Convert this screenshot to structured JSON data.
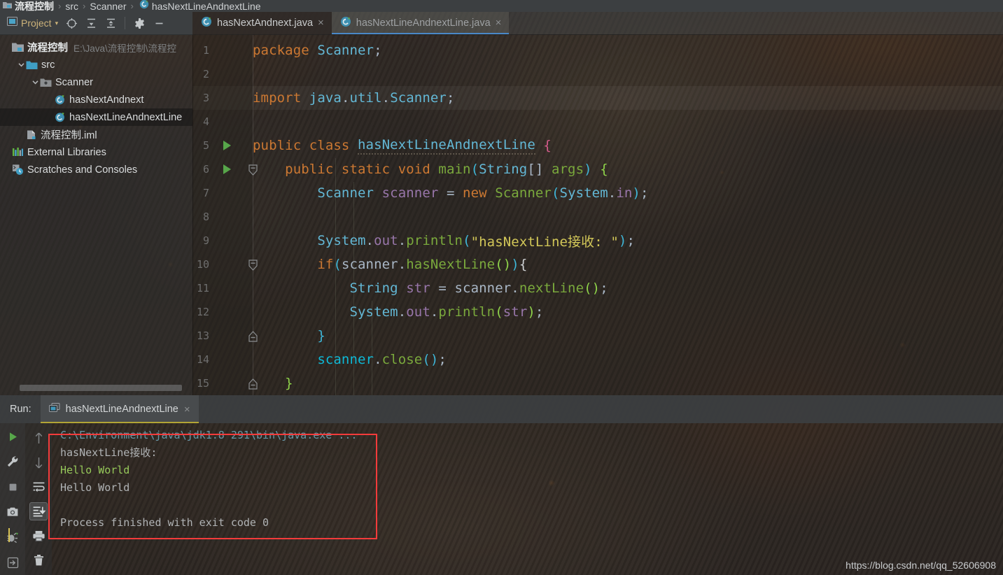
{
  "breadcrumb": {
    "items": [
      {
        "label": "流程控制",
        "icon": "project-icon",
        "bold": true
      },
      {
        "label": "src",
        "icon": "none",
        "bold": false
      },
      {
        "label": "Scanner",
        "icon": "none",
        "bold": false
      },
      {
        "label": "hasNextLineAndnextLine",
        "icon": "java-class-icon",
        "bold": false
      }
    ],
    "separator": "›"
  },
  "toolbar": {
    "project_label": "Project",
    "project_caret": "▾",
    "buttons": [
      {
        "name": "locate-icon",
        "title": "Select Opened File"
      },
      {
        "name": "expand-all-icon",
        "title": "Expand All"
      },
      {
        "name": "collapse-all-icon",
        "title": "Collapse All"
      },
      {
        "name": "gear-icon",
        "title": "Settings"
      },
      {
        "name": "minimize-icon",
        "title": "Hide"
      }
    ]
  },
  "editor_tabs": [
    {
      "label": "hasNextAndnext.java",
      "icon": "java-class-icon",
      "active": false,
      "close": "×"
    },
    {
      "label": "hasNextLineAndnextLine.java",
      "icon": "java-class-icon",
      "active": true,
      "close": "×"
    }
  ],
  "project_tree": [
    {
      "label": "流程控制",
      "path": "E:\\Java\\流程控制\\流程控",
      "icon": "project-folder-icon",
      "indent": 0,
      "arrow": "",
      "bold": true,
      "selected": false
    },
    {
      "label": "src",
      "path": "",
      "icon": "source-folder-icon",
      "indent": 1,
      "arrow": "▾",
      "bold": false,
      "selected": false
    },
    {
      "label": "Scanner",
      "path": "",
      "icon": "package-folder-icon",
      "indent": 2,
      "arrow": "▾",
      "bold": false,
      "selected": false
    },
    {
      "label": "hasNextAndnext",
      "path": "",
      "icon": "java-class-icon",
      "indent": 3,
      "arrow": "",
      "bold": false,
      "selected": false
    },
    {
      "label": "hasNextLineAndnextLine",
      "path": "",
      "icon": "java-class-icon",
      "indent": 3,
      "arrow": "",
      "bold": false,
      "selected": true
    },
    {
      "label": "流程控制.iml",
      "path": "",
      "icon": "iml-file-icon",
      "indent": 1,
      "arrow": "",
      "bold": false,
      "selected": false
    },
    {
      "label": "External Libraries",
      "path": "",
      "icon": "libraries-icon",
      "indent": 0,
      "arrow": "",
      "bold": false,
      "selected": false
    },
    {
      "label": "Scratches and Consoles",
      "path": "",
      "icon": "scratches-icon",
      "indent": 0,
      "arrow": "",
      "bold": false,
      "selected": false
    }
  ],
  "code": {
    "line_numbers": [
      1,
      2,
      3,
      4,
      5,
      6,
      7,
      8,
      9,
      10,
      11,
      12,
      13,
      14,
      15
    ],
    "lines": [
      {
        "n": 1,
        "tokens": [
          {
            "t": "package ",
            "c": "kw"
          },
          {
            "t": "Scanner",
            "c": "cls"
          },
          {
            "t": ";",
            "c": "punct"
          }
        ]
      },
      {
        "n": 2,
        "tokens": []
      },
      {
        "n": 3,
        "tokens": [
          {
            "t": "import ",
            "c": "kw"
          },
          {
            "t": "java",
            "c": "cls"
          },
          {
            "t": ".",
            "c": "punct"
          },
          {
            "t": "util",
            "c": "cls"
          },
          {
            "t": ".",
            "c": "punct"
          },
          {
            "t": "Scanner",
            "c": "cls"
          },
          {
            "t": ";",
            "c": "punct"
          }
        ]
      },
      {
        "n": 4,
        "tokens": []
      },
      {
        "n": 5,
        "tokens": [
          {
            "t": "public class ",
            "c": "kw"
          },
          {
            "t": "hasNextLineAndnextLine",
            "c": "cls wavy"
          },
          {
            "t": " ",
            "c": "punct"
          },
          {
            "t": "{",
            "c": "brc1"
          }
        ]
      },
      {
        "n": 6,
        "tokens": [
          {
            "t": "    ",
            "c": "punct"
          },
          {
            "t": "public static void ",
            "c": "kw"
          },
          {
            "t": "main",
            "c": "mth"
          },
          {
            "t": "(",
            "c": "brc3"
          },
          {
            "t": "String",
            "c": "cls"
          },
          {
            "t": "[] ",
            "c": "punct"
          },
          {
            "t": "args",
            "c": "mth"
          },
          {
            "t": ") ",
            "c": "brc3"
          },
          {
            "t": "{",
            "c": "brc2"
          }
        ]
      },
      {
        "n": 7,
        "tokens": [
          {
            "t": "        ",
            "c": "punct"
          },
          {
            "t": "Scanner",
            "c": "cls"
          },
          {
            "t": " ",
            "c": "punct"
          },
          {
            "t": "scanner",
            "c": "var"
          },
          {
            "t": " = ",
            "c": "punct"
          },
          {
            "t": "new ",
            "c": "kw"
          },
          {
            "t": "Scanner",
            "c": "mth"
          },
          {
            "t": "(",
            "c": "brc3"
          },
          {
            "t": "System",
            "c": "cls"
          },
          {
            "t": ".",
            "c": "punct"
          },
          {
            "t": "in",
            "c": "fld"
          },
          {
            "t": ")",
            "c": "brc3"
          },
          {
            "t": ";",
            "c": "punct"
          }
        ]
      },
      {
        "n": 8,
        "tokens": []
      },
      {
        "n": 9,
        "tokens": [
          {
            "t": "        ",
            "c": "punct"
          },
          {
            "t": "System",
            "c": "cls"
          },
          {
            "t": ".",
            "c": "punct"
          },
          {
            "t": "out",
            "c": "var"
          },
          {
            "t": ".",
            "c": "punct"
          },
          {
            "t": "println",
            "c": "mth"
          },
          {
            "t": "(",
            "c": "brc3"
          },
          {
            "t": "\"hasNextLine接收: \"",
            "c": "str"
          },
          {
            "t": ")",
            "c": "brc3"
          },
          {
            "t": ";",
            "c": "punct"
          }
        ]
      },
      {
        "n": 10,
        "tokens": [
          {
            "t": "        ",
            "c": "punct"
          },
          {
            "t": "if",
            "c": "kw"
          },
          {
            "t": "(",
            "c": "brc3"
          },
          {
            "t": "scanner",
            "c": "punct"
          },
          {
            "t": ".",
            "c": "punct"
          },
          {
            "t": "hasNextLine",
            "c": "mth"
          },
          {
            "t": "()",
            "c": "brc2"
          },
          {
            "t": ")",
            "c": "brc3"
          },
          {
            "t": "{",
            "c": "brc4"
          }
        ]
      },
      {
        "n": 11,
        "tokens": [
          {
            "t": "            ",
            "c": "punct"
          },
          {
            "t": "String",
            "c": "cls"
          },
          {
            "t": " ",
            "c": "punct"
          },
          {
            "t": "str",
            "c": "var"
          },
          {
            "t": " = ",
            "c": "punct"
          },
          {
            "t": "scanner",
            "c": "punct"
          },
          {
            "t": ".",
            "c": "punct"
          },
          {
            "t": "nextLine",
            "c": "mth"
          },
          {
            "t": "()",
            "c": "brc2"
          },
          {
            "t": ";",
            "c": "punct"
          }
        ]
      },
      {
        "n": 12,
        "tokens": [
          {
            "t": "            ",
            "c": "punct"
          },
          {
            "t": "System",
            "c": "cls"
          },
          {
            "t": ".",
            "c": "punct"
          },
          {
            "t": "out",
            "c": "var"
          },
          {
            "t": ".",
            "c": "punct"
          },
          {
            "t": "println",
            "c": "mth"
          },
          {
            "t": "(",
            "c": "brc2"
          },
          {
            "t": "str",
            "c": "var"
          },
          {
            "t": ")",
            "c": "brc2"
          },
          {
            "t": ";",
            "c": "punct"
          }
        ]
      },
      {
        "n": 13,
        "tokens": [
          {
            "t": "        ",
            "c": "punct"
          },
          {
            "t": "}",
            "c": "brc3"
          }
        ]
      },
      {
        "n": 14,
        "tokens": [
          {
            "t": "        ",
            "c": "punct"
          },
          {
            "t": "scanner",
            "c": "pl"
          },
          {
            "t": ".",
            "c": "punct"
          },
          {
            "t": "close",
            "c": "mth"
          },
          {
            "t": "()",
            "c": "brc3"
          },
          {
            "t": ";",
            "c": "punct"
          }
        ]
      },
      {
        "n": 15,
        "tokens": [
          {
            "t": "    ",
            "c": "punct"
          },
          {
            "t": "}",
            "c": "brc2"
          }
        ]
      }
    ],
    "run_arrow_lines": [
      5,
      6
    ],
    "fold_lines": [
      6,
      10,
      13,
      15
    ],
    "highlight_line": 3
  },
  "run_panel": {
    "label": "Run:",
    "tab": {
      "label": "hasNextLineAndnextLine",
      "icon": "run-config-icon",
      "close": "×"
    },
    "left_buttons": [
      {
        "name": "rerun-icon",
        "title": "Rerun"
      },
      {
        "name": "wrench-icon",
        "title": "Edit Configuration"
      },
      {
        "name": "stop-icon",
        "title": "Stop"
      },
      {
        "name": "camera-icon",
        "title": "Dump Threads"
      },
      {
        "name": "debug-icon",
        "title": "Debug"
      },
      {
        "name": "exit-icon",
        "title": "Exit"
      }
    ],
    "left_buttons2": [
      {
        "name": "arrow-up-icon",
        "title": "Up the Stack Trace"
      },
      {
        "name": "arrow-down-icon",
        "title": "Down the Stack Trace"
      },
      {
        "name": "soft-wrap-icon",
        "title": "Soft-Wrap"
      },
      {
        "name": "scroll-to-end-icon",
        "title": "Scroll to End",
        "active": true
      },
      {
        "name": "print-icon",
        "title": "Print"
      },
      {
        "name": "trash-icon",
        "title": "Clear All"
      }
    ],
    "console_lines": [
      {
        "text": "C:\\Environment\\java\\jdk1.8 291\\bin\\java.exe ...",
        "kind": "c-sys"
      },
      {
        "text": "hasNextLine接收:",
        "kind": "c-out"
      },
      {
        "text": "Hello World",
        "kind": "c-in"
      },
      {
        "text": "Hello World",
        "kind": "c-out"
      },
      {
        "text": "",
        "kind": "c-out"
      },
      {
        "text": "Process finished with exit code 0",
        "kind": "c-out"
      }
    ]
  },
  "annotation": {
    "highlight_color": "#f33b3b"
  },
  "watermark": "https://blog.csdn.net/qq_52606908"
}
